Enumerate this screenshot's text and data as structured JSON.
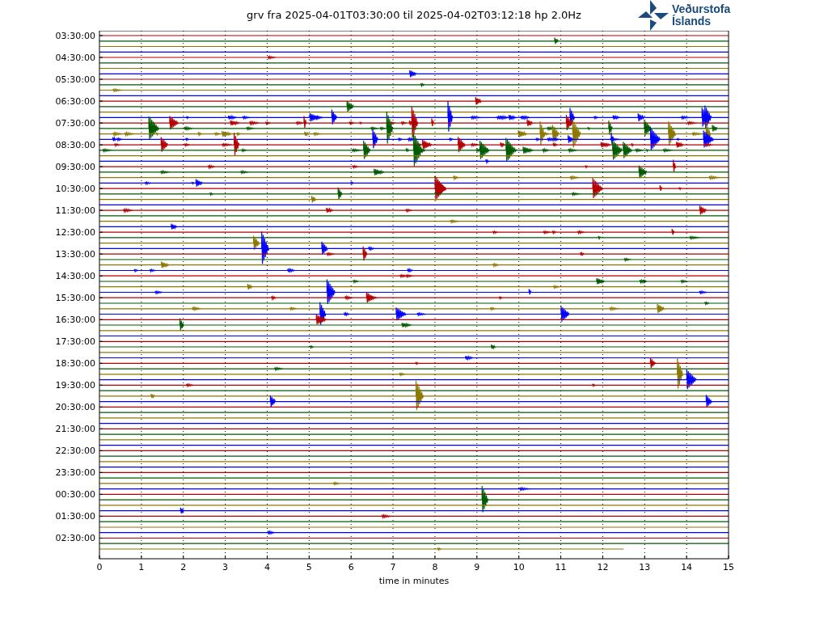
{
  "title": "grv fra 2025-04-01T03:30:00 til 2025-04-02T03:12:18 hp 2.0Hz",
  "logo": {
    "lines": [
      "Veðurstofa",
      "Íslands"
    ]
  },
  "y_labels": [
    "03:30:00",
    "04:30:00",
    "05:30:00",
    "06:30:00",
    "07:30:00",
    "08:30:00",
    "09:30:00",
    "10:30:00",
    "11:30:00",
    "12:30:00",
    "13:30:00",
    "14:30:00",
    "15:30:00",
    "16:30:00",
    "17:30:00",
    "18:30:00",
    "19:30:00",
    "20:30:00",
    "21:30:00",
    "22:30:00",
    "23:30:00",
    "00:30:00",
    "01:30:00",
    "02:30:00"
  ],
  "x_ticks": [
    "0",
    "1",
    "2",
    "3",
    "4",
    "5",
    "6",
    "7",
    "8",
    "9",
    "10",
    "11",
    "12",
    "13",
    "14",
    "15"
  ],
  "xlabel": "time in minutes"
}
